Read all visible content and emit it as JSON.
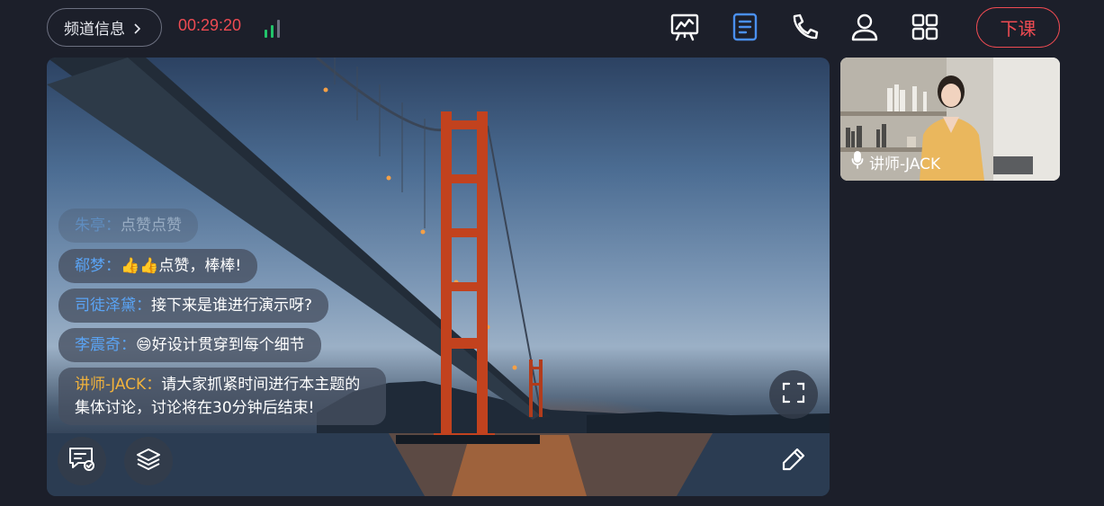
{
  "header": {
    "channel_info_label": "频道信息",
    "timer": "00:29:20",
    "end_class_label": "下课",
    "tools": [
      "whiteboard-icon",
      "document-icon",
      "phone-icon",
      "user-icon",
      "grid-icon"
    ],
    "active_tool": "document-icon",
    "signal_bars_active": 2,
    "signal_bars_total": 3
  },
  "chat": {
    "messages": [
      {
        "name": "朱亭：",
        "text": "点赞点赞",
        "faded": true
      },
      {
        "name": "郗梦：",
        "text": "👍👍点赞，棒棒!"
      },
      {
        "name": "司徒泽黛：",
        "text": "接下来是谁进行演示呀?"
      },
      {
        "name": "李震奇：",
        "text": "😄好设计贯穿到每个细节"
      },
      {
        "name": "讲师-JACK：",
        "text": "请大家抓紧时间进行本主题的集体讨论，讨论将在30分钟后结束!",
        "teacher": true
      }
    ]
  },
  "stage": {
    "controls": [
      "chat-icon",
      "layers-icon",
      "fullscreen-icon",
      "pen-icon"
    ]
  },
  "teacher_video": {
    "name": "讲师-JACK"
  },
  "colors": {
    "background": "#1c1f2a",
    "accent_blue": "#4a90f0",
    "alert_red": "#ee4b52",
    "teacher_gold": "#f1b23c",
    "signal_green": "#22c46a"
  }
}
